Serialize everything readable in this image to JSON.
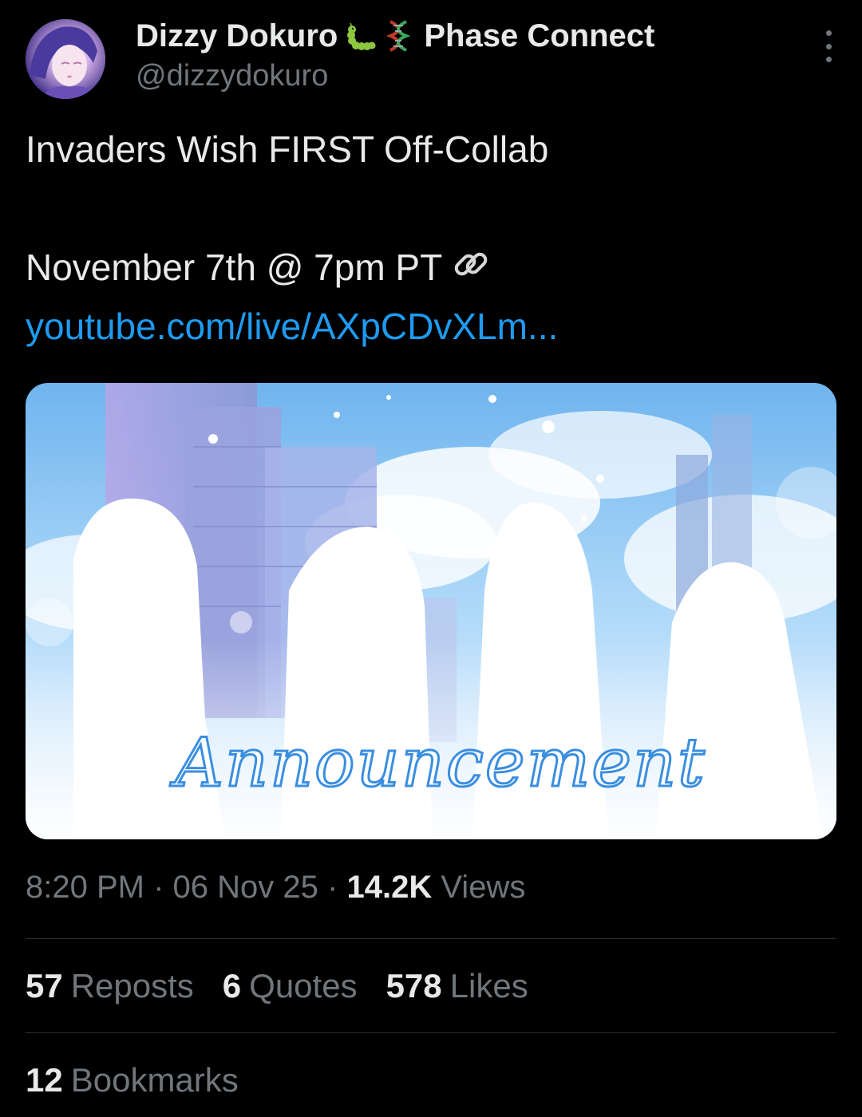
{
  "author": {
    "display_name": "Dizzy Dokuro",
    "affiliation": "Phase Connect",
    "handle": "@dizzydokuro",
    "name_emojis": [
      "caterpillar-emoji",
      "dna-emoji"
    ]
  },
  "tweet": {
    "line1": "Invaders Wish FIRST Off-Collab",
    "line2": "November 7th @ 7pm PT",
    "link_text": "youtube.com/live/AXpCDvXLm...",
    "link_icon": "link-icon",
    "media_text": "Announcement"
  },
  "meta": {
    "time": "8:20 PM",
    "separator": "·",
    "date": "06 Nov 25",
    "views_count": "14.2K",
    "views_label": "Views"
  },
  "stats": {
    "reposts_count": "57",
    "reposts_label": "Reposts",
    "quotes_count": "6",
    "quotes_label": "Quotes",
    "likes_count": "578",
    "likes_label": "Likes",
    "bookmarks_count": "12",
    "bookmarks_label": "Bookmarks"
  },
  "colors": {
    "background": "#000000",
    "text": "#e7e9ea",
    "secondary": "#71767b",
    "link": "#1d9bf0",
    "divider": "#2f3336"
  }
}
